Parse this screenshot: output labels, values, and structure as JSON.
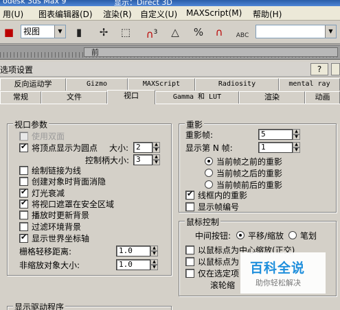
{
  "titlebar": {
    "app": "odesk 3ds Max 9",
    "renderer": "显示：Direct 3D"
  },
  "menu": {
    "items": [
      {
        "label": "用(U)"
      },
      {
        "label": "图表编辑器(D)"
      },
      {
        "label": "渲染(R)"
      },
      {
        "label": "自定义(U)"
      },
      {
        "label": "MAXScript(M)"
      },
      {
        "label": "帮助(H)"
      }
    ]
  },
  "toolbar": {
    "view_combo": "视图",
    "selection_set_combo": "",
    "icons": [
      "select-and-move-icon",
      "select-object-icon",
      "snap-3d-icon",
      "angle-snap-icon",
      "percent-snap-icon",
      "spinner-snap-icon",
      "edit-named-selections-icon"
    ],
    "snap_labels": {
      "snap3": "3",
      "percent": "%",
      "abc": "ABC"
    }
  },
  "timeline": {
    "label": "前"
  },
  "dialog": {
    "title": "选项设置",
    "help_button": "?",
    "tabs_row1": [
      {
        "label": "反向运动学"
      },
      {
        "label": "Gizmo"
      },
      {
        "label": "MAXScript"
      },
      {
        "label": "Radiosity"
      },
      {
        "label": "mental ray"
      }
    ],
    "tabs_row2": [
      {
        "label": "常规"
      },
      {
        "label": "文件"
      },
      {
        "label": "视口"
      },
      {
        "label": "Gamma 和 LUT"
      },
      {
        "label": "渲染"
      },
      {
        "label": "动画"
      }
    ],
    "active_tab": "视口"
  },
  "viewport_params": {
    "title": "视口参数",
    "use_dual_planes": "使用双面",
    "show_vertices_as_dots": "将顶点显示为圆点",
    "size_label": "大小:",
    "size_value": "2",
    "handle_size_label": "控制柄大小:",
    "handle_size_value": "3",
    "draw_links_as_lines": "绘制链接为线",
    "backface_cull_on_create": "创建对象时背面消隐",
    "attenuate_lights": "灯光衰减",
    "mask_safe_region": "将视口遮罩在安全区域",
    "update_bg_while_playing": "播放时更新背景",
    "filter_env_bg": "过滤环境背景",
    "display_world_axis": "显示世界坐标轴",
    "grid_nudge_label": "栅格轻移距离:",
    "grid_nudge_value": "1.0",
    "non_scaling_size_label": "非缩放对象大小:",
    "non_scaling_size_value": "1.0"
  },
  "ghosting": {
    "title": "重影",
    "frames_label": "重影帧:",
    "frames_value": "5",
    "nth_label": "显示第 N 帧:",
    "nth_value": "1",
    "before": "当前帧之前的重影",
    "after": "当前帧之后的重影",
    "before_after": "当前帧前后的重影",
    "wireframe": "线框内的重影",
    "show_frame_numbers": "显示帧编号"
  },
  "mouse_control": {
    "title": "鼠标控制",
    "middle_button_label": "中间按钮:",
    "pan_zoom": "平移/缩放",
    "stroke": "笔划",
    "zoom_about_point_ortho": "以鼠标点为中心缩放(正交)",
    "zoom_about_point_persp": "以鼠标点为",
    "only_in_selected": "仅在选定项",
    "wheel_zoom_label": "滚轮缩"
  },
  "display_drivers": {
    "title": "显示驱动程序"
  },
  "watermark": {
    "brand": "百科全说",
    "slogan": "助你轻松解决"
  }
}
